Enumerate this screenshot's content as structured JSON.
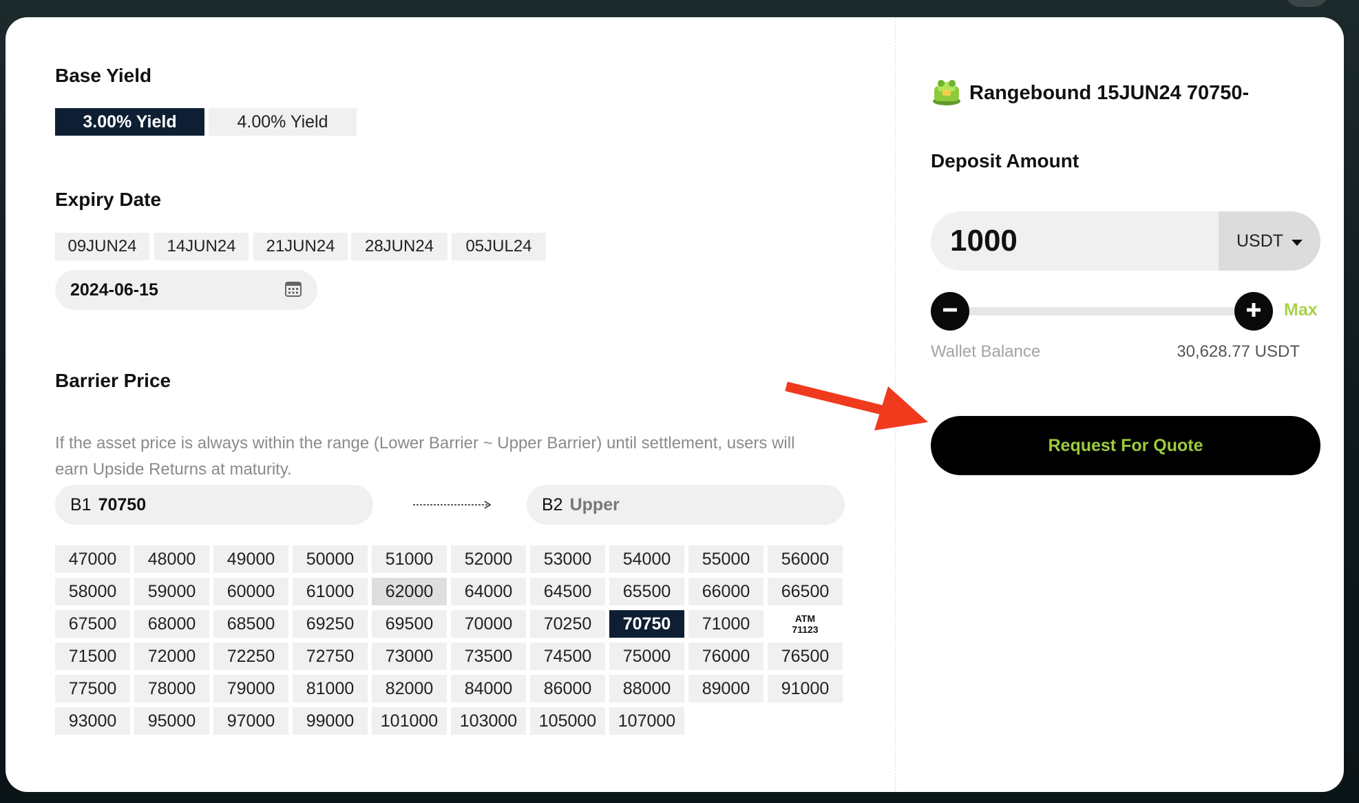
{
  "base_yield": {
    "title": "Base Yield",
    "options": [
      "3.00% Yield",
      "4.00% Yield"
    ],
    "selected": "3.00% Yield"
  },
  "expiry": {
    "title": "Expiry Date",
    "chips": [
      "09JUN24",
      "14JUN24",
      "21JUN24",
      "28JUN24",
      "05JUL24"
    ],
    "date_value": "2024-06-15"
  },
  "barrier": {
    "title": "Barrier Price",
    "description": "If the asset price is always within the range (Lower Barrier ~ Upper Barrier) until settlement, users will earn Upside Returns at maturity.",
    "b1_label": "B1",
    "b1_value": "70750",
    "b2_label": "B2",
    "b2_value": "Upper",
    "prices": [
      "47000",
      "48000",
      "49000",
      "50000",
      "51000",
      "52000",
      "53000",
      "54000",
      "55000",
      "56000",
      "58000",
      "59000",
      "60000",
      "61000",
      "62000",
      "64000",
      "64500",
      "65500",
      "66000",
      "66500",
      "67500",
      "68000",
      "68500",
      "69250",
      "69500",
      "70000",
      "70250",
      "70750",
      "71000",
      "ATM",
      "71500",
      "72000",
      "72250",
      "72750",
      "73000",
      "73500",
      "74500",
      "75000",
      "76000",
      "76500",
      "77500",
      "78000",
      "79000",
      "81000",
      "82000",
      "84000",
      "86000",
      "88000",
      "89000",
      "91000",
      "93000",
      "95000",
      "97000",
      "99000",
      "101000",
      "103000",
      "105000",
      "107000"
    ],
    "selected_price": "70750",
    "hovered_price": "62000",
    "atm": {
      "label": "ATM",
      "value": "71123"
    }
  },
  "product": {
    "title": "Rangebound 15JUN24 70750-"
  },
  "deposit": {
    "title": "Deposit Amount",
    "amount": "1000",
    "currency": "USDT",
    "max_label": "Max",
    "wallet_label": "Wallet Balance",
    "wallet_value": "30,628.77 USDT",
    "slider_fraction": 0.03
  },
  "actions": {
    "rfq_label": "Request For Quote"
  },
  "colors": {
    "accent_green": "#9ccc3c",
    "selected_navy": "#0e1f33",
    "annotation_red": "#f03a1e"
  }
}
